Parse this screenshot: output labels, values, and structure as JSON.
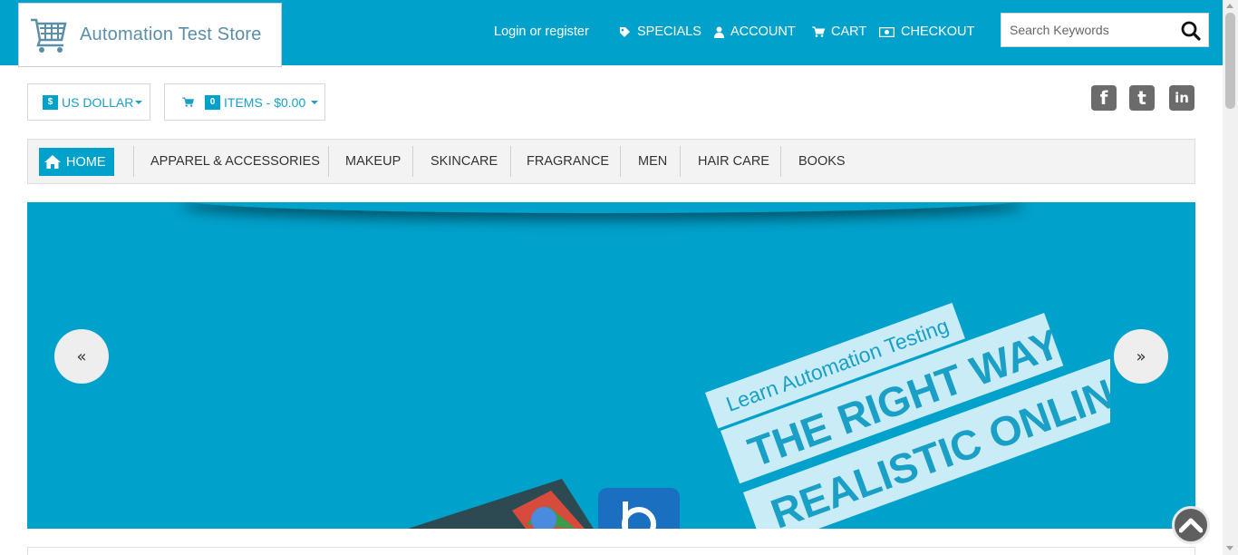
{
  "header": {
    "logo_text": "Automation Test Store",
    "login_label": "Login or register",
    "links": [
      {
        "label": "SPECIALS",
        "icon": "tag-icon"
      },
      {
        "label": "ACCOUNT",
        "icon": "user-icon"
      },
      {
        "label": "CART",
        "icon": "cart-icon"
      },
      {
        "label": "CHECKOUT",
        "icon": "money-icon"
      }
    ],
    "search_placeholder": "Search Keywords"
  },
  "toolbar": {
    "currency_symbol": "$",
    "currency_label": "US DOLLAR",
    "cart_count": "0",
    "cart_label": "ITEMS - $0.00"
  },
  "social": [
    "f",
    "t",
    "in"
  ],
  "nav": {
    "home_label": "HOME",
    "items": [
      "APPAREL & ACCESSORIES",
      "MAKEUP",
      "SKINCARE",
      "FRAGRANCE",
      "MEN",
      "HAIR CARE",
      "BOOKS"
    ]
  },
  "banner": {
    "line1": "Learn Automation Testing",
    "line2": "THE RIGHT WAY",
    "line3": "REALISTIC ONLINE",
    "prev_symbol": "«",
    "next_symbol": "»"
  },
  "colors": {
    "brand": "#00a1cb",
    "nav_bg": "#f3f3f3"
  }
}
